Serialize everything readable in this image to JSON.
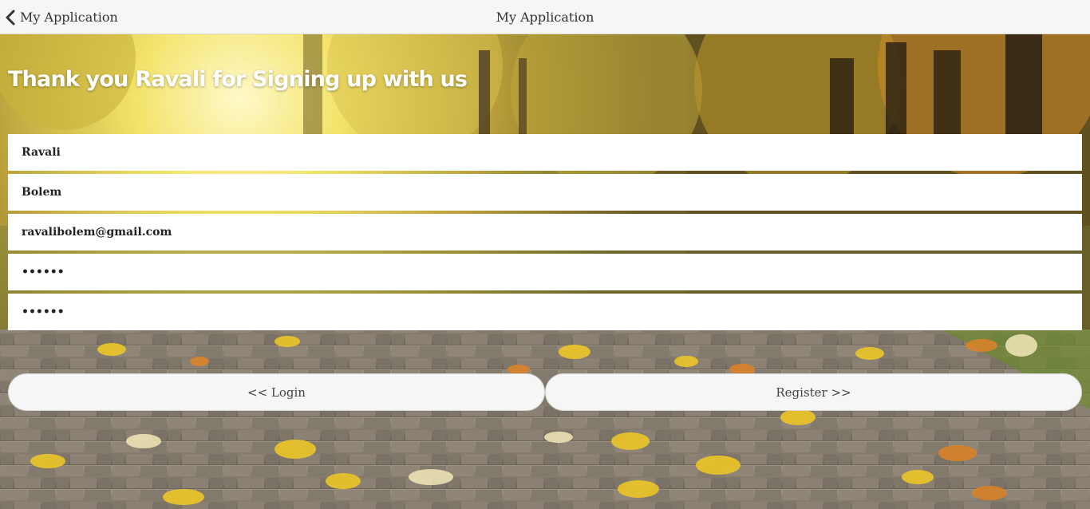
{
  "header": {
    "back_label": "My Application",
    "title": "My Application"
  },
  "heading": "Thank you Ravali for Signing up with us",
  "form": {
    "first_name": "Ravali",
    "last_name": "Bolem",
    "email": "ravalibolem@gmail.com",
    "password": "••••••",
    "confirm_password": "••••••"
  },
  "buttons": {
    "login_label": "<< Login",
    "register_label": "Register >>"
  },
  "colors": {
    "header_bg": "#f6f6f6",
    "button_bg": "#f6f6f6",
    "heading_text": "#ffffff"
  },
  "background": {
    "description_icon": "autumn-park-path-image"
  }
}
